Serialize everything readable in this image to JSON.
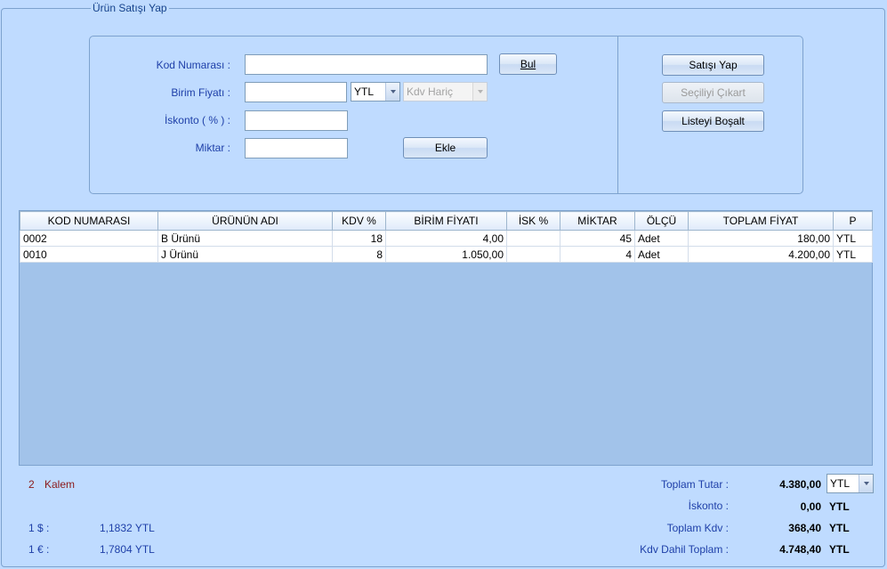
{
  "group_title": "Ürün Satışı Yap",
  "form": {
    "kod_label": "Kod Numarası :",
    "kod_value": "",
    "bul_label": "Bul",
    "birim_label": "Birim Fiyatı :",
    "birim_value": "",
    "currency_value": "YTL",
    "kdv_mode_value": "Kdv Hariç",
    "iskonto_label": "İskonto ( % ) :",
    "iskonto_value": "",
    "miktar_label": "Miktar :",
    "miktar_value": "",
    "ekle_label": "Ekle"
  },
  "actions": {
    "satis_label": "Satışı Yap",
    "cikart_label": "Seçiliyi Çıkart",
    "bosalt_label": "Listeyi Boşalt"
  },
  "grid": {
    "columns": [
      "KOD NUMARASI",
      "ÜRÜNÜN ADI",
      "KDV %",
      "BİRİM FİYATI",
      "İSK %",
      "MİKTAR",
      "ÖLÇÜ",
      "TOPLAM FİYAT",
      "P"
    ],
    "rows": [
      [
        "0002",
        "B Ürünü",
        "18",
        "4,00",
        "",
        "45",
        "Adet",
        "180,00",
        "YTL"
      ],
      [
        "0010",
        "J Ürünü",
        "8",
        "1.050,00",
        "",
        "4",
        "Adet",
        "4.200,00",
        "YTL"
      ]
    ]
  },
  "footer": {
    "kalem_count": "2",
    "kalem_label": "Kalem",
    "dollar_label": "1 $ :",
    "dollar_value": "1,1832 YTL",
    "euro_label": "1 € :",
    "euro_value": "1,7804 YTL",
    "toplam_tutar_label": "Toplam Tutar :",
    "toplam_tutar_value": "4.380,00",
    "toplam_currency": "YTL",
    "iskonto_label": "İskonto :",
    "iskonto_value": "0,00",
    "iskonto_currency": "YTL",
    "toplam_kdv_label": "Toplam Kdv :",
    "toplam_kdv_value": "368,40",
    "toplam_kdv_currency": "YTL",
    "kdv_dahil_label": "Kdv Dahil Toplam :",
    "kdv_dahil_value": "4.748,40",
    "kdv_dahil_currency": "YTL"
  },
  "colors": {
    "background": "#bfdbff",
    "grid_empty": "#a2c3ea",
    "label_blue": "#1e3fa8",
    "accent_red": "#8b1a1a"
  },
  "icons": [
    "chevron-down-icon"
  ]
}
